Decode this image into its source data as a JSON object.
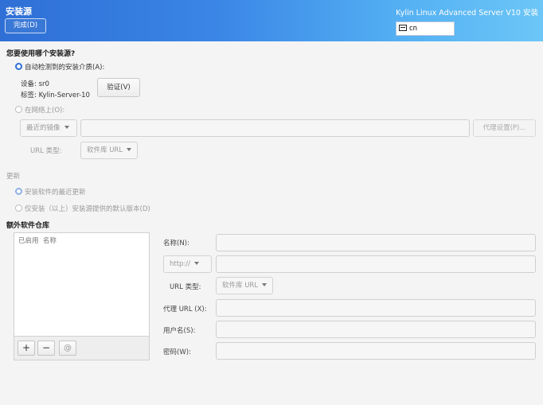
{
  "header": {
    "title": "安装源",
    "done_label": "完成(D)",
    "product": "Kylin Linux Advanced Server V10 安装",
    "keyboard_layout": "cn"
  },
  "source": {
    "question": "您要使用哪个安装源?",
    "auto_detect_label": "自动检测到的安装介质(A):",
    "device_label": "设备:",
    "device_value": "sr0",
    "tag_label": "标签:",
    "tag_value": "Kylin-Server-10",
    "verify_label": "验证(V)",
    "network_label": "在网络上(O):",
    "mirror_combo": "最近的镜像",
    "proxy_button": "代理设置(P)...",
    "url_type_label": "URL 类型:",
    "url_type_value": "软件库 URL"
  },
  "updates": {
    "title": "更新",
    "latest_label": "安装软件的最近更新",
    "base_only_label": "仅安装（以上）安装源提供的默认版本(D)"
  },
  "extra_repos": {
    "title": "额外软件仓库",
    "col_enabled": "已启用",
    "col_name": "名称",
    "add_label": "+",
    "remove_label": "−",
    "reset_label": "@"
  },
  "repo_form": {
    "name_label": "名称(N):",
    "protocol_value": "http://",
    "url_type_label": "URL 类型:",
    "url_type_value": "软件库 URL",
    "proxy_url_label": "代理 URL (X):",
    "username_label": "用户名(S):",
    "password_label": "密码(W):"
  },
  "colors": {
    "accent": "#2f6fd6",
    "header_gradient_end": "#6cc6f7"
  }
}
